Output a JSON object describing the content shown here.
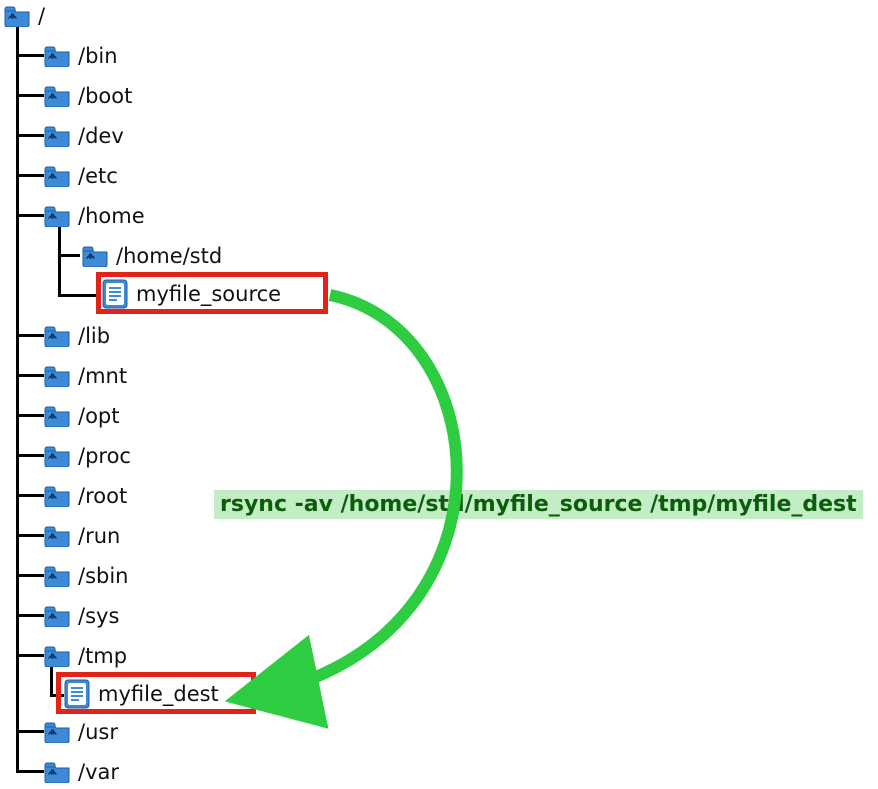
{
  "tree": {
    "root": "/",
    "bin": "/bin",
    "boot": "/boot",
    "dev": "/dev",
    "etc": "/etc",
    "home": "/home",
    "home_std": "/home/std",
    "myfile_source": "myfile_source",
    "lib": "/lib",
    "mnt": "/mnt",
    "opt": "/opt",
    "proc": "/proc",
    "root2": "/root",
    "run": "/run",
    "sbin": "/sbin",
    "sys": "/sys",
    "tmp": "/tmp",
    "myfile_dest": "myfile_dest",
    "usr": "/usr",
    "var": "/var"
  },
  "command": "rsync -av /home/std/myfile_source /tmp/myfile_dest",
  "colors": {
    "highlight_border": "#e2231a",
    "arrow": "#2ecc40",
    "cmd_bg": "#c3edc4",
    "cmd_fg": "#0d5c0d",
    "folder_fill": "#3f8ad8",
    "folder_stroke": "#1e5fa3",
    "file_fill": "#3f8ad8"
  }
}
